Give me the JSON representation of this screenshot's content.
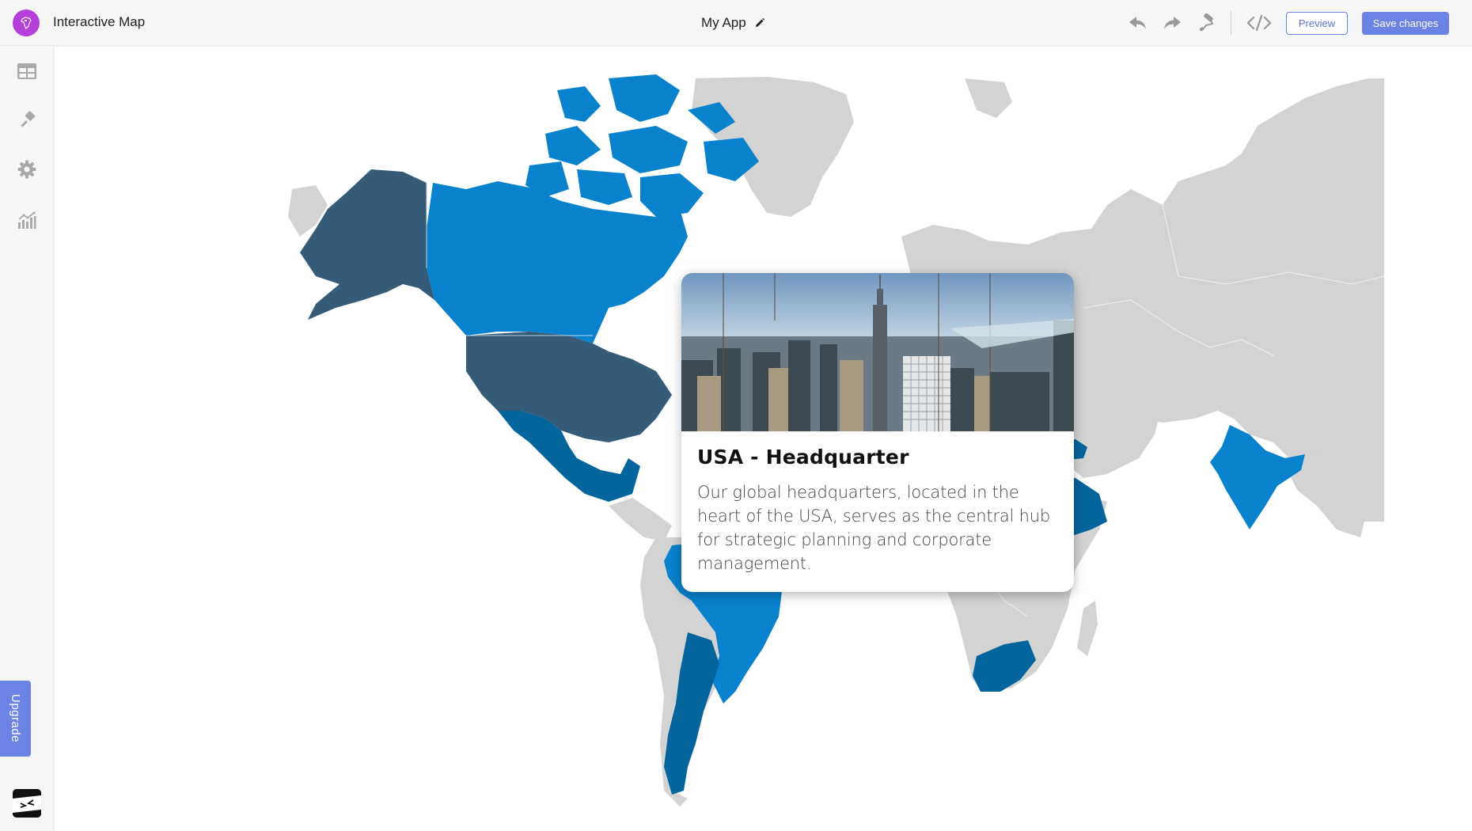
{
  "app": {
    "title": "Interactive Map",
    "logo_icon": "africa-map-icon",
    "project_name": "My App",
    "edit_icon": "pencil-icon"
  },
  "toolbar": {
    "undo_icon": "undo-icon",
    "redo_icon": "redo-icon",
    "paint_icon": "paint-roller-icon",
    "code_icon": "code-icon",
    "preview_label": "Preview",
    "save_label": "Save changes"
  },
  "sidebar": {
    "items": [
      {
        "name": "content",
        "icon": "table-icon"
      },
      {
        "name": "design",
        "icon": "paintbrush-icon"
      },
      {
        "name": "settings",
        "icon": "gear-icon"
      },
      {
        "name": "analytics",
        "icon": "chart-icon"
      }
    ],
    "upgrade_label": "Upgrade"
  },
  "colors": {
    "accent": "#6b83e4",
    "logo": "#b43fd9",
    "map_land": "#d3d3d3",
    "map_light_blue": "#0882cc",
    "map_mid_blue": "#04649c",
    "map_dark_slate": "#345b78"
  },
  "map": {
    "highlighted_countries": [
      {
        "name": "Canada",
        "color": "#0882cc"
      },
      {
        "name": "USA",
        "color": "#345b78"
      },
      {
        "name": "Alaska (USA)",
        "color": "#345b78"
      },
      {
        "name": "Mexico",
        "color": "#04649c"
      },
      {
        "name": "Brazil",
        "color": "#0882cc"
      },
      {
        "name": "Argentina",
        "color": "#04649c"
      },
      {
        "name": "Turkey",
        "color": "#04649c"
      },
      {
        "name": "Saudi Arabia",
        "color": "#04649c"
      },
      {
        "name": "India",
        "color": "#0882cc"
      },
      {
        "name": "South Africa",
        "color": "#04649c"
      }
    ]
  },
  "popup": {
    "title": "USA - Headquarter",
    "description": "Our global headquarters, located in the heart of the USA, serves as the central hub for strategic planning and corporate management.",
    "image_alt": "New York City skyline"
  }
}
